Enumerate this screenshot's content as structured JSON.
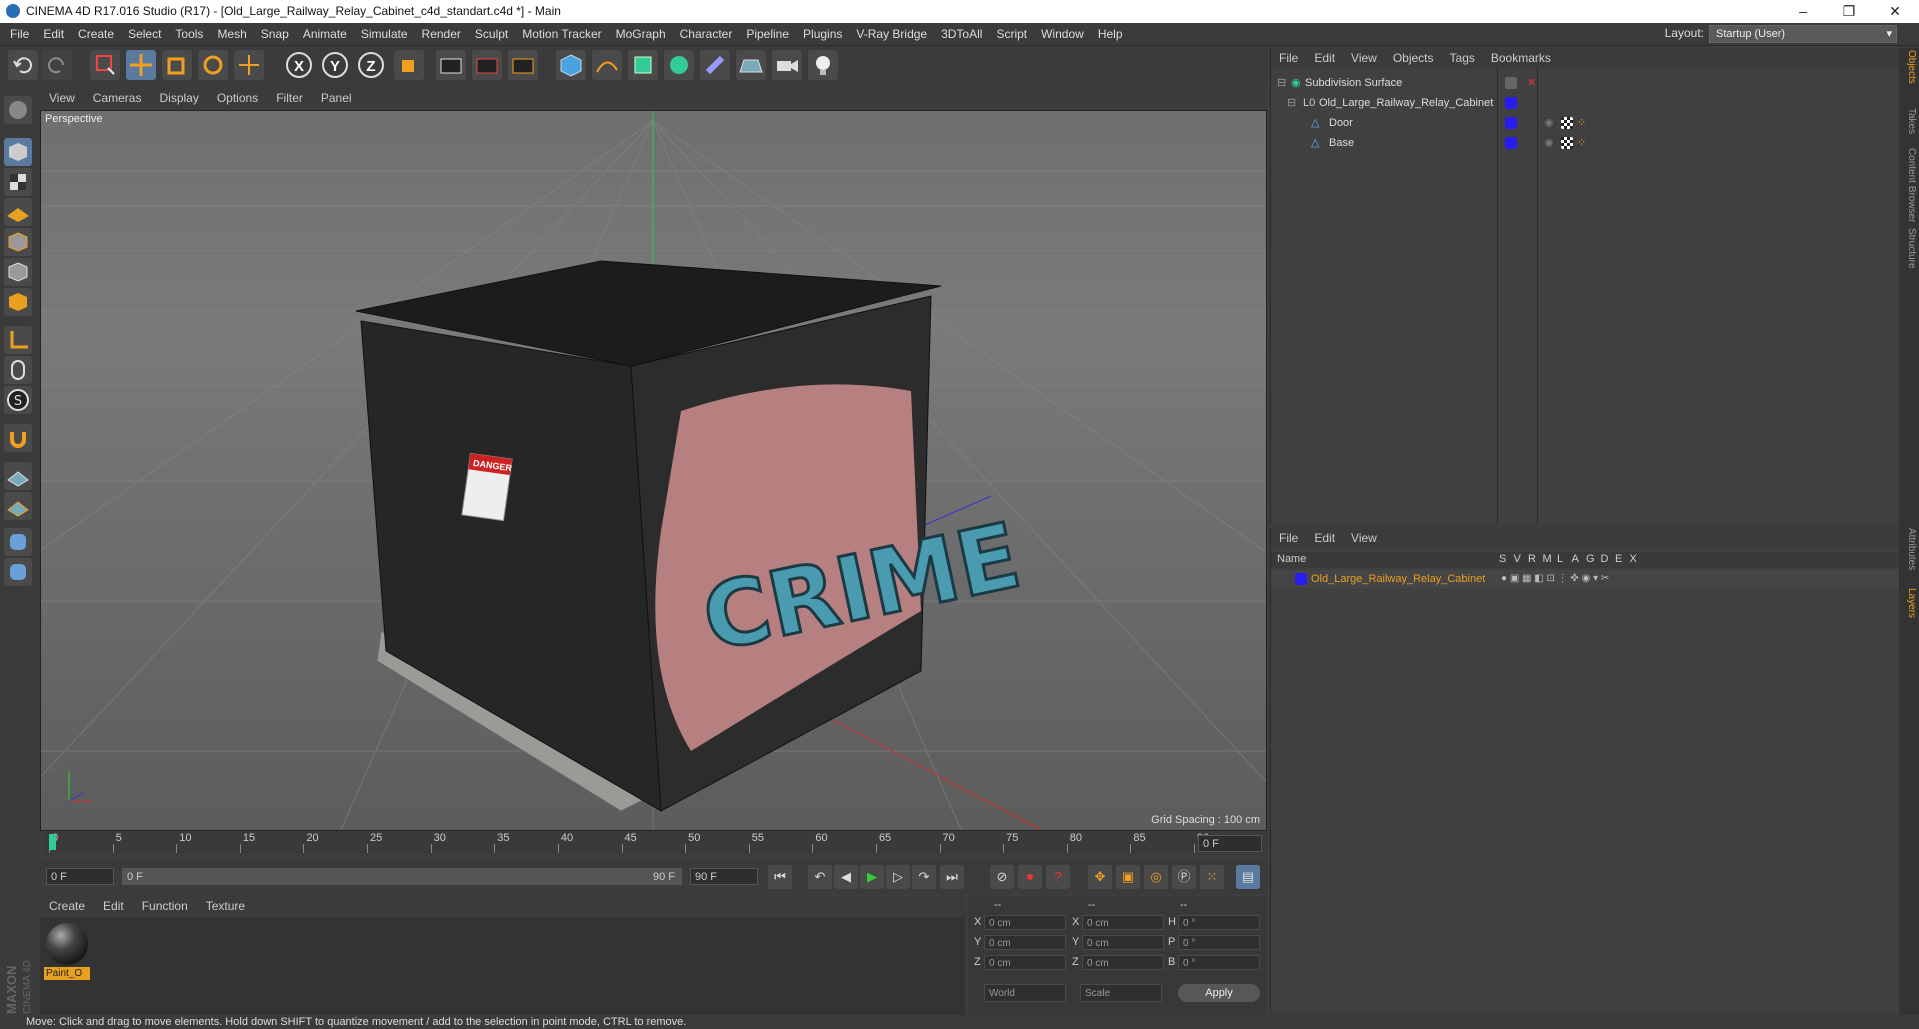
{
  "window": {
    "title": "CINEMA 4D R17.016 Studio (R17) - [Old_Large_Railway_Relay_Cabinet_c4d_standart.c4d *] - Main",
    "minimize": "–",
    "maximize": "❐",
    "close": "✕"
  },
  "menu": [
    "File",
    "Edit",
    "Create",
    "Select",
    "Tools",
    "Mesh",
    "Snap",
    "Animate",
    "Simulate",
    "Render",
    "Sculpt",
    "Motion Tracker",
    "MoGraph",
    "Character",
    "Pipeline",
    "Plugins",
    "V-Ray Bridge",
    "3DToAll",
    "Script",
    "Window",
    "Help"
  ],
  "layout": {
    "label": "Layout:",
    "value": "Startup (User)"
  },
  "toolbar": {
    "axis_x": "X",
    "axis_y": "Y",
    "axis_z": "Z"
  },
  "viewport": {
    "menu": [
      "View",
      "Cameras",
      "Display",
      "Options",
      "Filter",
      "Panel"
    ],
    "label": "Perspective",
    "grid_spacing": "Grid Spacing : 100 cm",
    "sign_text": "DANGER",
    "graffiti": "CRIME"
  },
  "timeline": {
    "ticks": [
      "0",
      "5",
      "10",
      "15",
      "20",
      "25",
      "30",
      "35",
      "40",
      "45",
      "50",
      "55",
      "60",
      "65",
      "70",
      "75",
      "80",
      "85",
      "90"
    ],
    "frame_end_display": "0 F",
    "start_field": "0 F",
    "range_start": "0 F",
    "range_end": "90 F",
    "end_field": "90 F"
  },
  "materials": {
    "menu": [
      "Create",
      "Edit",
      "Function",
      "Texture"
    ],
    "items": [
      {
        "name": "Paint_O"
      }
    ]
  },
  "coords": {
    "headers": [
      "--",
      "--",
      "--"
    ],
    "rows": [
      {
        "a": "X",
        "av": "0 cm",
        "b": "X",
        "bv": "0 cm",
        "c": "H",
        "cv": "0 °"
      },
      {
        "a": "Y",
        "av": "0 cm",
        "b": "Y",
        "bv": "0 cm",
        "c": "P",
        "cv": "0 °"
      },
      {
        "a": "Z",
        "av": "0 cm",
        "b": "Z",
        "bv": "0 cm",
        "c": "B",
        "cv": "0 °"
      }
    ],
    "world": "World",
    "scale": "Scale",
    "apply": "Apply"
  },
  "objects": {
    "menu": [
      "File",
      "Edit",
      "View",
      "Objects",
      "Tags",
      "Bookmarks"
    ],
    "tree": [
      {
        "name": "Subdivision Surface"
      },
      {
        "name": "Old_Large_Railway_Relay_Cabinet"
      },
      {
        "name": "Door"
      },
      {
        "name": "Base"
      }
    ]
  },
  "layers": {
    "menu": [
      "File",
      "Edit",
      "View"
    ],
    "columns_name": "Name",
    "columns": [
      "S",
      "V",
      "R",
      "M",
      "L",
      "A",
      "G",
      "D",
      "E",
      "X"
    ],
    "rows": [
      {
        "name": "Old_Large_Railway_Relay_Cabinet"
      }
    ]
  },
  "side_tabs": [
    "Objects",
    "Takes",
    "Content Browser",
    "Structure",
    "Attributes",
    "Layers"
  ],
  "logo": {
    "brand": "MAXON",
    "product": "CINEMA 4D"
  },
  "status": "Move: Click and drag to move elements. Hold down SHIFT to quantize movement / add to the selection in point mode, CTRL to remove.",
  "colors": {
    "layer_blue": "#2a1cf0",
    "selected_orange": "#e8a020",
    "accent": "#5a7aa0"
  }
}
